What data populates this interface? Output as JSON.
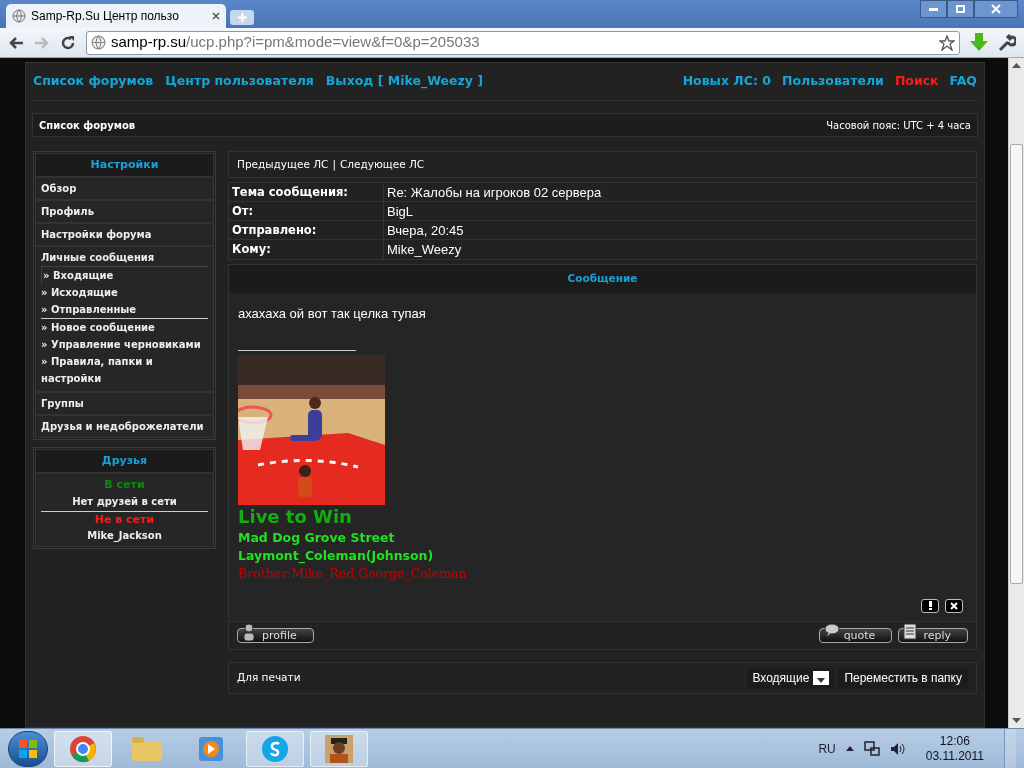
{
  "browser": {
    "tab_title": "Samp-Rp.Su Центр пользо",
    "url_host": "samp-rp.su",
    "url_path": "/ucp.php?i=pm&mode=view&f=0&p=205033"
  },
  "nav": {
    "left": [
      {
        "label": "Список форумов"
      },
      {
        "label": "Центр пользователя"
      },
      {
        "label": "Выход [ Mike_Weezy ]"
      }
    ],
    "right": [
      {
        "label": "Новых ЛС: 0",
        "kind": "normal"
      },
      {
        "label": "Пользователи",
        "kind": "normal"
      },
      {
        "label": "Поиск",
        "kind": "alert"
      },
      {
        "label": "FAQ",
        "kind": "normal"
      }
    ]
  },
  "breadcrumb": {
    "label": "Список форумов",
    "timezone": "Часовой пояс: UTC + 4 часа"
  },
  "sidebar": {
    "title": "Настройки",
    "items": [
      {
        "label": "Обзор"
      },
      {
        "label": "Профиль"
      },
      {
        "label": "Настройки форума"
      },
      {
        "label": "Личные сообщения",
        "children": [
          {
            "label": "» Входящие",
            "selected": true,
            "divider_after": false
          },
          {
            "label": "» Исходящие",
            "selected": false,
            "divider_after": false
          },
          {
            "label": "» Отправленные",
            "selected": false,
            "divider_after": true
          },
          {
            "label": "» Новое сообщение",
            "selected": false,
            "divider_after": false
          },
          {
            "label": "» Управление черновиками",
            "selected": false,
            "divider_after": false
          },
          {
            "label": "» Правила, папки и настройки",
            "selected": false,
            "divider_after": false
          }
        ]
      },
      {
        "label": "Группы"
      },
      {
        "label": "Друзья и недоброжелатели"
      }
    ]
  },
  "friends": {
    "title": "Друзья",
    "online_label": "В сети",
    "online_text": "Нет друзей в сети",
    "offline_label": "Не в сети",
    "offline_names": [
      "Mike_Jackson"
    ]
  },
  "pm_nav": {
    "prev": "Предыдущее ЛС",
    "separator": "|",
    "next": "Следующее ЛС"
  },
  "headers": [
    {
      "label": "Тема сообщения:",
      "value": "Re: Жалобы на игроков 02 сервера"
    },
    {
      "label": "От:",
      "value": "BigL"
    },
    {
      "label": "Отправлено:",
      "value": "Вчера, 20:45"
    },
    {
      "label": "Кому:",
      "value": "Mike_Weezy"
    }
  ],
  "message": {
    "title": "Сообщение",
    "body": "ахахаха ой вот так целка тупая",
    "signature": [
      {
        "text": "Live to Win",
        "kind": "heading",
        "color": "#0fb00f"
      },
      {
        "text": "Mad Dog Grove Street",
        "kind": "line",
        "color": "#22e022"
      },
      {
        "text": "Laymont_Coleman(Johnson)",
        "kind": "line",
        "color": "#22e022"
      },
      {
        "text": "Brother:Mike_Red,George_Coleman",
        "kind": "plain",
        "color": "#c80000"
      }
    ]
  },
  "post_buttons": {
    "profile": "profile",
    "quote": "quote",
    "reply": "reply"
  },
  "footer": {
    "print": "Для печати",
    "folder": "Входящие",
    "move": "Переместить в папку"
  },
  "taskbar": {
    "lang": "RU",
    "time": "12:06",
    "date": "03.11.2011"
  }
}
